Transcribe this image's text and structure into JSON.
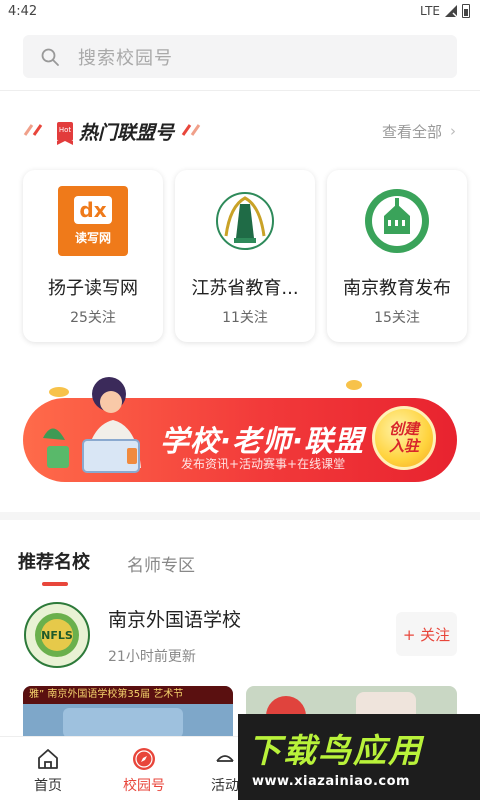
{
  "status_bar": {
    "time": "4:42",
    "network": "LTE"
  },
  "search": {
    "placeholder": "搜索校园号"
  },
  "alliance": {
    "badge": "Hot",
    "title": "热门联盟号",
    "view_all": "查看全部",
    "cards": [
      {
        "name": "扬子读写网",
        "followers": "25关注",
        "logo_text": "读写网"
      },
      {
        "name": "江苏省教育...",
        "followers": "11关注"
      },
      {
        "name": "南京教育发布",
        "followers": "15关注"
      }
    ]
  },
  "banner": {
    "title": "学校·老师·联盟",
    "subtitle": "发布资讯+活动赛事+在线课堂",
    "badge": [
      "创建",
      "入驻"
    ]
  },
  "tabs": [
    {
      "label": "推荐名校",
      "active": true
    },
    {
      "label": "名师专区",
      "active": false
    }
  ],
  "school": {
    "name": "南京外国语学校",
    "updated": "21小时前更新",
    "follow_label": "+ 关注",
    "logo_text": "NFLS",
    "thumb_caption": "雅” 南京外国语学校第35届 艺术节"
  },
  "bottom_nav": [
    {
      "label": "首页",
      "icon": "home-icon",
      "active": false
    },
    {
      "label": "校园号",
      "icon": "compass-icon",
      "active": true
    },
    {
      "label": "活动",
      "icon": "activity-icon",
      "active": false
    }
  ],
  "watermark": {
    "title": "下载鸟应用",
    "url": "www.xiazainiao.com"
  },
  "colors": {
    "accent": "#e8463b",
    "search_bg": "#f4f4f5",
    "watermark_green": "#b9f23a"
  }
}
